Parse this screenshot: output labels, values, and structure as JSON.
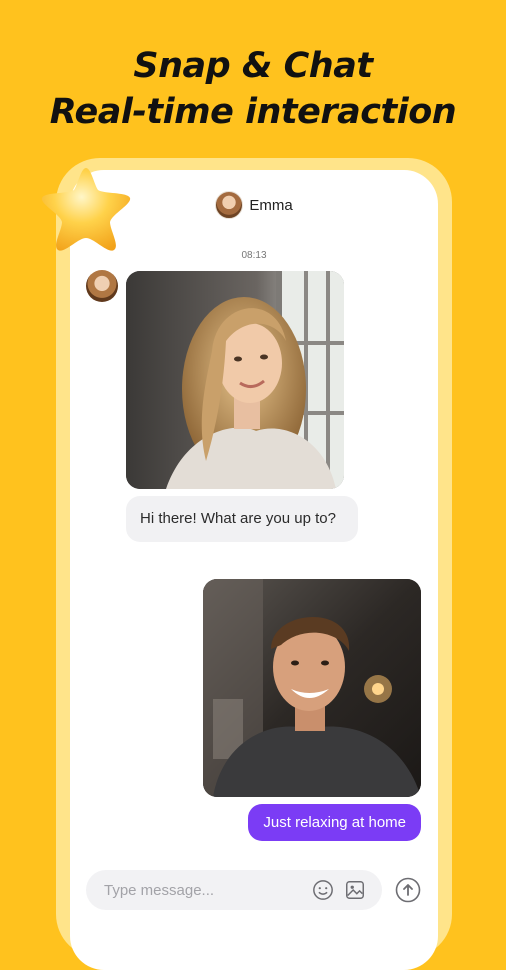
{
  "headline": {
    "line1": "Snap & Chat",
    "line2": "Real-time interaction"
  },
  "chat": {
    "contact_name": "Emma",
    "timestamp": "08:13",
    "incoming_message": "Hi there! What are you up to?",
    "outgoing_message": "Just relaxing at home"
  },
  "composer": {
    "placeholder": "Type message..."
  },
  "icons": {
    "star": "star-icon",
    "emoji": "emoji-icon",
    "image": "image-icon",
    "send": "send-arrow-icon"
  },
  "colors": {
    "background": "#FFC21E",
    "outgoing_bubble": "#7B3CF5",
    "incoming_bubble": "#F1F1F3"
  }
}
